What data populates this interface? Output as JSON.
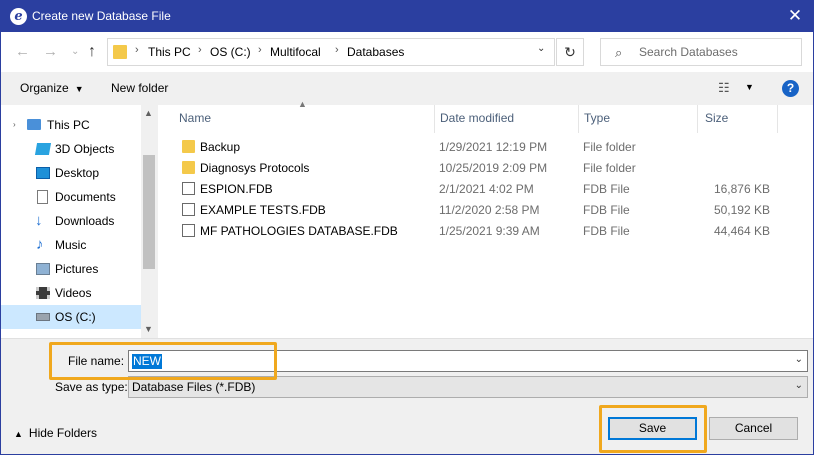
{
  "window": {
    "title": "Create new Database File",
    "app_icon": "e"
  },
  "nav": {
    "breadcrumbs": [
      "This PC",
      "OS (C:)",
      "Multifocal",
      "Databases"
    ],
    "search_placeholder": "Search Databases"
  },
  "toolbar": {
    "organize": "Organize",
    "new_folder": "New folder"
  },
  "sidebar": {
    "items": [
      {
        "label": "This PC",
        "icon": "pc-icon"
      },
      {
        "label": "3D Objects",
        "icon": "3d-objects-icon"
      },
      {
        "label": "Desktop",
        "icon": "desktop-icon"
      },
      {
        "label": "Documents",
        "icon": "documents-icon"
      },
      {
        "label": "Downloads",
        "icon": "downloads-icon"
      },
      {
        "label": "Music",
        "icon": "music-icon"
      },
      {
        "label": "Pictures",
        "icon": "pictures-icon"
      },
      {
        "label": "Videos",
        "icon": "videos-icon"
      },
      {
        "label": "OS (C:)",
        "icon": "drive-icon",
        "selected": true
      }
    ]
  },
  "files": {
    "columns": {
      "name": "Name",
      "date": "Date modified",
      "type": "Type",
      "size": "Size"
    },
    "rows": [
      {
        "name": "Backup",
        "date": "1/29/2021 12:19 PM",
        "type": "File folder",
        "size": "",
        "kind": "folder"
      },
      {
        "name": "Diagnosys Protocols",
        "date": "10/25/2019 2:09 PM",
        "type": "File folder",
        "size": "",
        "kind": "folder"
      },
      {
        "name": "ESPION.FDB",
        "date": "2/1/2021 4:02 PM",
        "type": "FDB File",
        "size": "16,876 KB",
        "kind": "file"
      },
      {
        "name": "EXAMPLE TESTS.FDB",
        "date": "11/2/2020 2:58 PM",
        "type": "FDB File",
        "size": "50,192 KB",
        "kind": "file"
      },
      {
        "name": "MF PATHOLOGIES DATABASE.FDB",
        "date": "1/25/2021 9:39 AM",
        "type": "FDB File",
        "size": "44,464 KB",
        "kind": "file"
      }
    ]
  },
  "form": {
    "file_name_label": "File name:",
    "file_name_value": "NEW",
    "save_type_label": "Save as type:",
    "save_type_value": "Database Files (*.FDB)"
  },
  "footer": {
    "hide_folders": "Hide Folders",
    "save": "Save",
    "cancel": "Cancel"
  },
  "colors": {
    "titlebar": "#2b3fa0",
    "highlight": "#f0a81e",
    "selection": "#0078d7"
  }
}
